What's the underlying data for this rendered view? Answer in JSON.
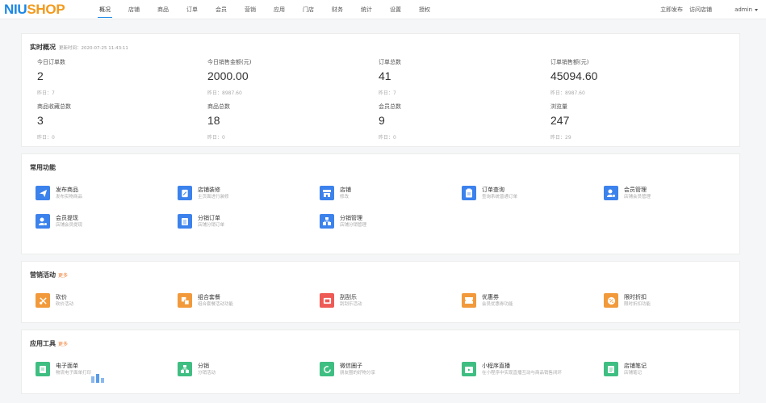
{
  "header": {
    "logo": {
      "main": "NIU",
      "accent": "SHOP"
    },
    "nav": [
      "概况",
      "店铺",
      "商品",
      "订单",
      "会员",
      "营销",
      "应用",
      "门店",
      "财务",
      "统计",
      "设置",
      "授权"
    ],
    "active_nav": "概况",
    "links": [
      "立即发布",
      "访问店铺"
    ],
    "user": "admin"
  },
  "overview": {
    "title": "实时概况",
    "update_time": "更新时间：2020-07-25 11:43:11",
    "stats": [
      {
        "label": "今日订单数",
        "value": "2",
        "yesterday": "昨日：7"
      },
      {
        "label": "今日销售金额(元)",
        "value": "2000.00",
        "yesterday": "昨日：8987.60"
      },
      {
        "label": "订单总数",
        "value": "41",
        "yesterday": "昨日：7"
      },
      {
        "label": "订单销售额(元)",
        "value": "45094.60",
        "yesterday": "昨日：8987.60"
      },
      {
        "label": "商品收藏总数",
        "value": "3",
        "yesterday": "昨日：0"
      },
      {
        "label": "商品总数",
        "value": "18",
        "yesterday": "昨日：0"
      },
      {
        "label": "会员总数",
        "value": "9",
        "yesterday": "昨日：0"
      },
      {
        "label": "浏览量",
        "value": "247",
        "yesterday": "昨日：29"
      }
    ]
  },
  "common": {
    "title": "常用功能",
    "items": [
      {
        "name": "发布商品",
        "desc": "发布实物商品",
        "icon": "paper-plane-icon",
        "color": "blue"
      },
      {
        "name": "店铺装修",
        "desc": "主页面进行装修",
        "icon": "edit-doc-icon",
        "color": "blue"
      },
      {
        "name": "店铺",
        "desc": "修改",
        "icon": "store-icon",
        "color": "blue"
      },
      {
        "name": "订单查询",
        "desc": "查询系统普通订单",
        "icon": "clipboard-icon",
        "color": "blue"
      },
      {
        "name": "会员管理",
        "desc": "店铺会员管理",
        "icon": "user-gear-icon",
        "color": "blue"
      },
      {
        "name": "会员提现",
        "desc": "店铺会员提现",
        "icon": "user-money-icon",
        "color": "blue"
      },
      {
        "name": "分销订单",
        "desc": "店铺分销订单",
        "icon": "list-icon",
        "color": "blue"
      },
      {
        "name": "分销管理",
        "desc": "店铺分销管理",
        "icon": "org-icon",
        "color": "blue"
      }
    ]
  },
  "marketing": {
    "title": "营销活动",
    "more": "更多",
    "items": [
      {
        "name": "砍价",
        "desc": "砍价活动",
        "icon": "cut-icon",
        "color": "orange"
      },
      {
        "name": "组合套餐",
        "desc": "组合套餐活动功能",
        "icon": "bundle-icon",
        "color": "orange"
      },
      {
        "name": "刮刮乐",
        "desc": "刮刮乐活动",
        "icon": "scratch-card-icon",
        "color": "red"
      },
      {
        "name": "优惠券",
        "desc": "会员优惠券功能",
        "icon": "coupon-icon",
        "color": "orange"
      },
      {
        "name": "限时折扣",
        "desc": "限时折扣功能",
        "icon": "discount-icon",
        "color": "orange"
      }
    ]
  },
  "tools": {
    "title": "应用工具",
    "more": "更多",
    "items": [
      {
        "name": "电子面单",
        "desc": "物流电子面单打印",
        "icon": "waybill-icon",
        "color": "green"
      },
      {
        "name": "分销",
        "desc": "分销活动",
        "icon": "distribution-icon",
        "color": "green"
      },
      {
        "name": "微信圈子",
        "desc": "朋友圈的好物分享",
        "icon": "circle-icon",
        "color": "green"
      },
      {
        "name": "小程序直播",
        "desc": "在小程序中实现直播互动与商品销售闭环",
        "icon": "live-icon",
        "color": "green"
      },
      {
        "name": "店铺笔记",
        "desc": "店铺笔记",
        "icon": "notebook-icon",
        "color": "green"
      }
    ]
  }
}
